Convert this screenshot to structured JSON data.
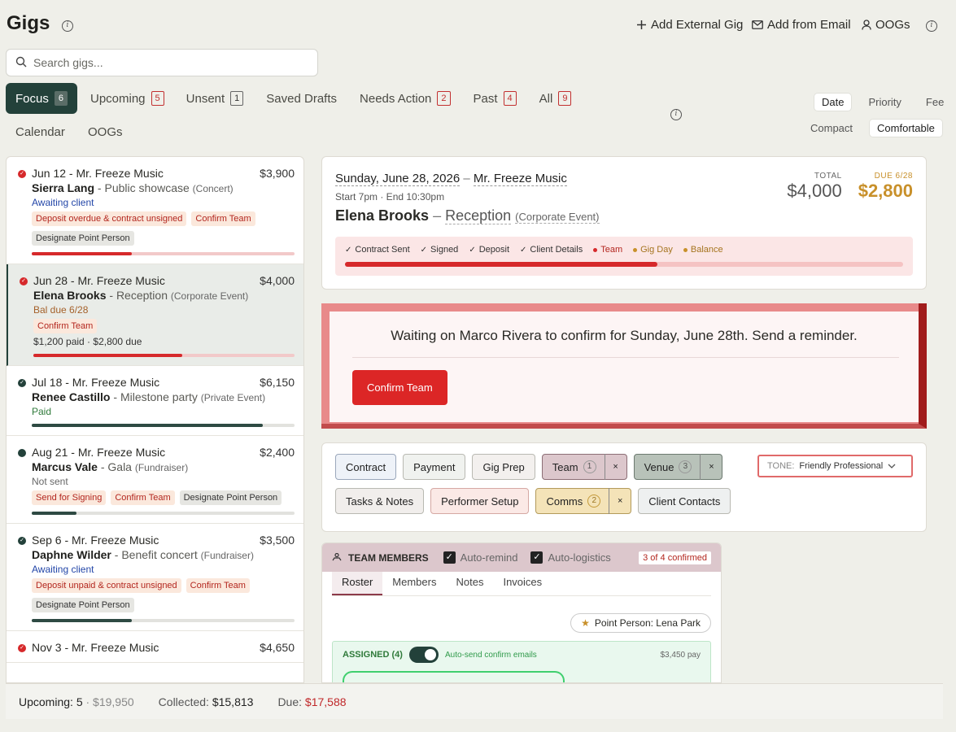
{
  "header": {
    "title": "Gigs",
    "actions": {
      "add_external": "Add External Gig",
      "add_email": "Add from Email",
      "oogs": "OOGs"
    }
  },
  "search": {
    "placeholder": "Search gigs..."
  },
  "tabs": [
    {
      "label": "Focus",
      "count": "6"
    },
    {
      "label": "Upcoming",
      "count": "5"
    },
    {
      "label": "Unsent",
      "count": "1"
    },
    {
      "label": "Saved Drafts"
    },
    {
      "label": "Needs Action",
      "count": "2"
    },
    {
      "label": "Past",
      "count": "4"
    },
    {
      "label": "All",
      "count": "9"
    }
  ],
  "tabs2": [
    "Calendar",
    "OOGs"
  ],
  "sort": {
    "options": [
      "Date",
      "Priority",
      "Fee"
    ],
    "selected": "Date"
  },
  "density": {
    "options": [
      "Compact",
      "Comfortable"
    ],
    "selected": "Comfortable"
  },
  "gigs": [
    {
      "date_client": "Jun 12 - Mr. Freeze Music",
      "amount": "$3,900",
      "name": "Sierra Lang",
      "event": "Public showcase",
      "category": "(Concert)",
      "status": "Awaiting client",
      "status_color": "#2346a8",
      "chips": [
        {
          "t": "Deposit overdue & contract unsigned",
          "c": "red"
        },
        {
          "t": "Confirm Team",
          "c": "red"
        },
        {
          "t": "Designate Point Person",
          "c": "gray"
        }
      ],
      "progress": 0.38,
      "bar": "#d6292b",
      "icon": "red-check"
    },
    {
      "date_client": "Jun 28 - Mr. Freeze Music",
      "amount": "$4,000",
      "name": "Elena Brooks",
      "event": "Reception",
      "category": "(Corporate Event)",
      "status": "Bal due 6/28",
      "status_color": "#a5612a",
      "chips": [
        {
          "t": "Confirm Team",
          "c": "red"
        }
      ],
      "paid_line": "$1,200 paid · $2,800 due",
      "progress": 0.57,
      "bar": "#d6292b",
      "icon": "red-check"
    },
    {
      "date_client": "Jul 18 - Mr. Freeze Music",
      "amount": "$6,150",
      "name": "Renee Castillo",
      "event": "Milestone party",
      "category": "(Private Event)",
      "status": "Paid",
      "status_color": "#2f7a3a",
      "chips": [],
      "progress": 0.88,
      "bar": "#2e4a43",
      "icon": "dark-check"
    },
    {
      "date_client": "Aug 21 - Mr. Freeze Music",
      "amount": "$2,400",
      "name": "Marcus Vale",
      "event": "Gala",
      "category": "(Fundraiser)",
      "status": "Not sent",
      "status_color": "#666666",
      "chips": [
        {
          "t": "Send for Signing",
          "c": "red"
        },
        {
          "t": "Confirm Team",
          "c": "red"
        },
        {
          "t": "Designate Point Person",
          "c": "gray"
        }
      ],
      "progress": 0.17,
      "bar": "#2e4a43",
      "icon": "dark-dot"
    },
    {
      "date_client": "Sep 6 - Mr. Freeze Music",
      "amount": "$3,500",
      "name": "Daphne Wilder",
      "event": "Benefit concert",
      "category": "(Fundraiser)",
      "status": "Awaiting client",
      "status_color": "#2346a8",
      "chips": [
        {
          "t": "Deposit unpaid & contract unsigned",
          "c": "red"
        },
        {
          "t": "Confirm Team",
          "c": "red"
        },
        {
          "t": "Designate Point Person",
          "c": "gray"
        }
      ],
      "progress": 0.38,
      "bar": "#2e4a43",
      "icon": "dark-check"
    },
    {
      "date_client": "Nov 3 - Mr. Freeze Music",
      "amount": "$4,650",
      "name": "",
      "event": "",
      "category": "",
      "status": "",
      "chips": [],
      "progress": 0,
      "bar": "#2e4a43",
      "icon": "red-check"
    }
  ],
  "footer": {
    "upcoming_label": "Upcoming:",
    "upcoming_count": "5",
    "upcoming_amount": "· $19,950",
    "collected_label": "Collected:",
    "collected": "$15,813",
    "due_label": "Due:",
    "due": "$17,588"
  },
  "detail": {
    "date": "Sunday, June 28, 2026",
    "client": "Mr. Freeze Music",
    "time": "Start 7pm · End 10:30pm",
    "name": "Elena Brooks",
    "event": "Reception",
    "category": "(Corporate Event)",
    "total_label": "TOTAL",
    "total": "$4,000",
    "due_label": "DUE 6/28",
    "due": "$2,800",
    "steps": [
      {
        "l": "Contract Sent",
        "s": "done"
      },
      {
        "l": "Signed",
        "s": "done"
      },
      {
        "l": "Deposit",
        "s": "done"
      },
      {
        "l": "Client Details",
        "s": "done"
      },
      {
        "l": "Team",
        "s": "red"
      },
      {
        "l": "Gig Day",
        "s": "amber"
      },
      {
        "l": "Balance",
        "s": "amber"
      }
    ],
    "progress": 0.56
  },
  "alert": {
    "message": "Waiting on Marco Rivera to confirm for Sunday, June 28th. Send a reminder.",
    "button": "Confirm Team"
  },
  "actions": {
    "row1": [
      {
        "l": "Contract"
      },
      {
        "l": "Payment"
      },
      {
        "l": "Gig Prep"
      },
      {
        "l": "Team",
        "count": "1"
      },
      {
        "l": "Venue",
        "count": "3"
      }
    ],
    "row2": [
      {
        "l": "Tasks & Notes"
      },
      {
        "l": "Performer Setup"
      },
      {
        "l": "Comms",
        "count": "2"
      },
      {
        "l": "Client Contacts"
      }
    ],
    "close": "×",
    "tone_label": "TONE:",
    "tone_value": "Friendly Professional"
  },
  "team": {
    "title": "TEAM MEMBERS",
    "auto_remind": "Auto-remind",
    "auto_logistics": "Auto-logistics",
    "confirmed": "3 of 4 confirmed",
    "tabs": [
      "Roster",
      "Members",
      "Notes",
      "Invoices"
    ],
    "point_person": "Point Person: Lena Park",
    "assigned": "ASSIGNED (4)",
    "auto_send": "Auto-send confirm emails",
    "pay": "$3,450 pay"
  },
  "colors": {
    "accent": "#23413a",
    "alert_red": "#dc2626",
    "due_amber": "#c8902a"
  }
}
